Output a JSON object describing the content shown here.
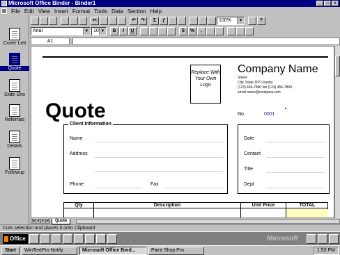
{
  "window": {
    "title": "Microsoft Office Binder - Binder1"
  },
  "menu": {
    "items": [
      "File",
      "Edit",
      "View",
      "Insert",
      "Format",
      "Tools",
      "Data",
      "Section",
      "Help"
    ]
  },
  "sections": [
    {
      "label": "Cover Lett",
      "active": false
    },
    {
      "label": "Quote",
      "active": true
    },
    {
      "label": "Slide Sho",
      "active": false
    },
    {
      "label": "Referrals",
      "active": false
    },
    {
      "label": "Details",
      "active": false
    },
    {
      "label": "Followup",
      "active": false
    }
  ],
  "toolbar": {
    "zoom_value": "100%",
    "font_name": "Arial",
    "font_size": "10"
  },
  "formula_bar": {
    "name_box": "A1"
  },
  "sheet": {
    "logo_placeholder": "Replace With Your Own Logo",
    "company_name": "Company Name",
    "company_street": "Street",
    "company_city": "City, State ZIP Country",
    "company_phone": "(123) 456-7890 fax (123) 456-7899",
    "company_email": "email name@company.com",
    "quote_title": "Quote",
    "quote_no_label": "No.",
    "quote_no_value": "0001",
    "client_heading": "Client Information",
    "client_fields": {
      "name": "Name",
      "address": "Address",
      "phone": "Phone",
      "fax": "Fax"
    },
    "side_fields": [
      "Date",
      "Contact",
      "Title",
      "Dept"
    ],
    "table_headers": [
      "Qty",
      "Description",
      "Unit Price",
      "TOTAL"
    ]
  },
  "tabs": {
    "active_tab": "Quote"
  },
  "status": {
    "text": "Cuts selection and places it onto Clipboard"
  },
  "office_bar": {
    "office_label": "Office",
    "brand": "Microsoft"
  },
  "taskbar": {
    "start": "Start",
    "buttons": [
      "WinTextPro Notify",
      "Microsoft Office Bind...",
      "Paint Shop Pro"
    ],
    "clock": "1:53 PM"
  },
  "colors": {
    "title_bar": "#000080",
    "quote_number": "#1a1ab0",
    "total_column": "#ffffc0"
  }
}
